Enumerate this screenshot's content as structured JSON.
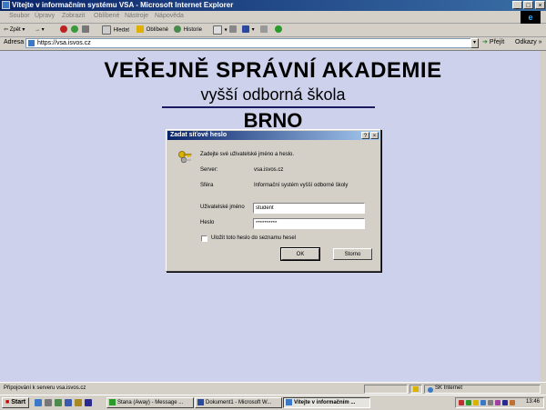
{
  "window": {
    "title": "Vítejte v informačním systému VSA - Microsoft Internet Explorer",
    "btn_min": "_",
    "btn_max": "□",
    "btn_close": "×"
  },
  "menu": [
    "Soubor",
    "Úpravy",
    "Zobrazit",
    "Oblíbené",
    "Nástroje",
    "Nápověda"
  ],
  "toolbar": {
    "back": "Zpět",
    "search": "Hledat",
    "favorites": "Oblíbené",
    "history": "Historie"
  },
  "address": {
    "label": "Adresa",
    "url": "https://vsa.isvos.cz",
    "go": "Přejít",
    "links": "Odkazy »"
  },
  "page": {
    "heading1": "VEŘEJNĚ SPRÁVNÍ AKADEMIE",
    "heading2": "vyšší odborná škola",
    "heading3": "BRNO"
  },
  "dialog": {
    "title": "Zadat síťové heslo",
    "help": "?",
    "close": "×",
    "prompt": "Zadejte své uživatelské jméno a heslo.",
    "server_label": "Server:",
    "server_value": "vsa.isvos.cz",
    "realm_label": "Sféra",
    "realm_value": "Informační systém vyšší odborné školy",
    "username_label": "Uživatelské jméno",
    "username_value": "student",
    "password_label": "Heslo",
    "password_value": "**********",
    "remember_label": "Uložit toto heslo do seznamu hesel",
    "ok": "OK",
    "cancel": "Storno"
  },
  "status": {
    "text": "Připojování k serveru vsa.isvos.cz",
    "zone": "SK Internet"
  },
  "taskbar": {
    "start": "Start",
    "tasks": [
      "Stana (Away) - Message ...",
      "Dokument1 - Microsoft W...",
      "Vítejte v informačním ..."
    ],
    "clock": "13:46"
  }
}
